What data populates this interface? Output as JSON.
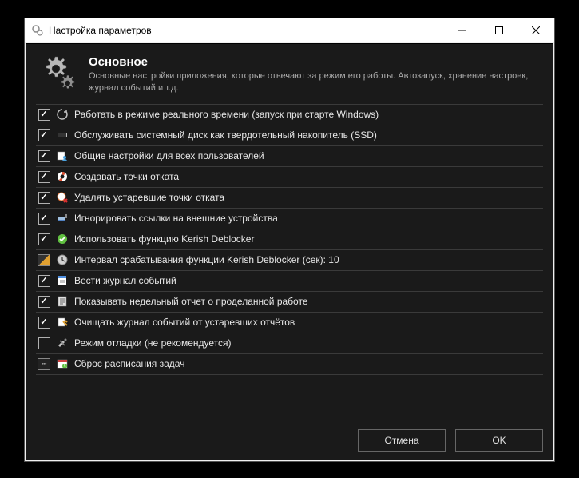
{
  "window": {
    "title": "Настройка параметров"
  },
  "header": {
    "title": "Основное",
    "subtitle": "Основные настройки приложения, которые отвечают за режим его работы. Автозапуск, хранение настроек, журнал событий и т.д."
  },
  "options": [
    {
      "control": "checkbox",
      "checked": true,
      "icon": "gear-refresh-icon",
      "iconColor": "#c0c0c0",
      "label": "Работать в режиме реального времени (запуск при старте Windows)"
    },
    {
      "control": "checkbox",
      "checked": true,
      "icon": "ssd-icon",
      "iconColor": "#c0c0c0",
      "label": "Обслуживать системный диск как твердотельный накопитель (SSD)"
    },
    {
      "control": "checkbox",
      "checked": true,
      "icon": "users-icon",
      "iconColor": "#4aa3e0",
      "label": "Общие настройки для всех пользователей"
    },
    {
      "control": "checkbox",
      "checked": true,
      "icon": "lifebuoy-icon",
      "iconColor": "#e05030",
      "label": "Создавать точки отката"
    },
    {
      "control": "checkbox",
      "checked": true,
      "icon": "delete-point-icon",
      "iconColor": "#e07030",
      "label": "Удалять устаревшие точки отката"
    },
    {
      "control": "checkbox",
      "checked": true,
      "icon": "link-device-icon",
      "iconColor": "#5080c0",
      "label": "Игнорировать ссылки на внешние устройства"
    },
    {
      "control": "checkbox",
      "checked": true,
      "icon": "shield-ok-icon",
      "iconColor": "#60c040",
      "label": "Использовать функцию Kerish Deblocker"
    },
    {
      "control": "edit",
      "checked": false,
      "icon": "clock-icon",
      "iconColor": "#d0d0d0",
      "label": "Интервал срабатывания функции Kerish Deblocker (сек): 10"
    },
    {
      "control": "checkbox",
      "checked": true,
      "icon": "log-icon",
      "iconColor": "#5090e0",
      "label": "Вести журнал событий"
    },
    {
      "control": "checkbox",
      "checked": true,
      "icon": "report-icon",
      "iconColor": "#e0e0e0",
      "label": "Показывать недельный отчет о проделанной работе"
    },
    {
      "control": "checkbox",
      "checked": true,
      "icon": "broom-icon",
      "iconColor": "#e0a030",
      "label": "Очищать журнал событий от устаревших отчётов"
    },
    {
      "control": "checkbox",
      "checked": false,
      "icon": "debug-icon",
      "iconColor": "#c0c0c0",
      "label": "Режим отладки (не рекомендуется)"
    },
    {
      "control": "action",
      "checked": false,
      "icon": "schedule-icon",
      "iconColor": "#60c040",
      "label": "Сброс расписания задач"
    }
  ],
  "footer": {
    "cancel": "Отмена",
    "ok": "OK"
  }
}
